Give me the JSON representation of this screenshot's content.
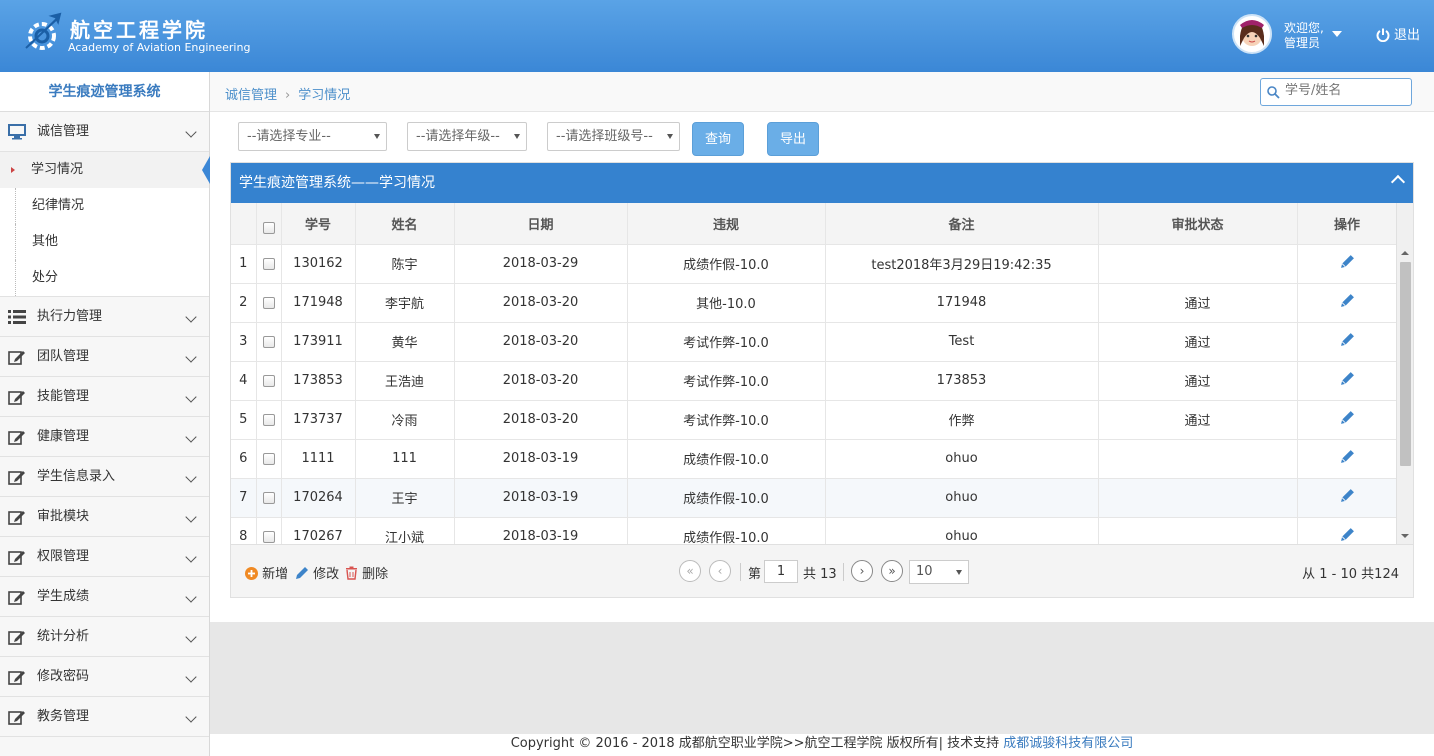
{
  "header": {
    "logo_cn": "航空工程学院",
    "logo_en": "Academy of Aviation Engineering",
    "welcome_line1": "欢迎您,",
    "welcome_line2": "管理员",
    "logout_label": "退出",
    "background_color": "#4a96df"
  },
  "sidebar": {
    "title": "学生痕迹管理系统",
    "items": [
      {
        "label": "诚信管理",
        "icon": "monitor-icon",
        "expanded": true
      },
      {
        "label": "执行力管理",
        "icon": "list-icon"
      },
      {
        "label": "团队管理",
        "icon": "edit-icon"
      },
      {
        "label": "技能管理",
        "icon": "edit-icon"
      },
      {
        "label": "健康管理",
        "icon": "edit-icon"
      },
      {
        "label": "学生信息录入",
        "icon": "edit-icon"
      },
      {
        "label": "审批模块",
        "icon": "edit-icon"
      },
      {
        "label": "权限管理",
        "icon": "edit-icon"
      },
      {
        "label": "学生成绩",
        "icon": "edit-icon"
      },
      {
        "label": "统计分析",
        "icon": "edit-icon"
      },
      {
        "label": "修改密码",
        "icon": "edit-icon"
      },
      {
        "label": "教务管理",
        "icon": "edit-icon"
      }
    ],
    "subitems": [
      "学习情况",
      "纪律情况",
      "其他",
      "处分"
    ]
  },
  "breadcrumb": {
    "parent": "诚信管理",
    "current": "学习情况"
  },
  "search": {
    "placeholder": "学号/姓名"
  },
  "filters": {
    "major": "--请选择专业--",
    "grade": "--请选择年级--",
    "class": "--请选择班级号--",
    "query_label": "查询",
    "export_label": "导出"
  },
  "panel": {
    "title": "学生痕迹管理系统——学习情况"
  },
  "table": {
    "headers": [
      "学号",
      "姓名",
      "日期",
      "违规",
      "备注",
      "审批状态",
      "操作"
    ],
    "rows": [
      {
        "idx": "1",
        "id": "130162",
        "name": "陈宇",
        "date": "2018-03-29",
        "violation": "成绩作假-10.0",
        "note": "test2018年3月29日19:42:35",
        "status": ""
      },
      {
        "idx": "2",
        "id": "171948",
        "name": "李宇航",
        "date": "2018-03-20",
        "violation": "其他-10.0",
        "note": "171948",
        "status": "通过"
      },
      {
        "idx": "3",
        "id": "173911",
        "name": "黄华",
        "date": "2018-03-20",
        "violation": "考试作弊-10.0",
        "note": "Test",
        "status": "通过"
      },
      {
        "idx": "4",
        "id": "173853",
        "name": "王浩迪",
        "date": "2018-03-20",
        "violation": "考试作弊-10.0",
        "note": "173853",
        "status": "通过"
      },
      {
        "idx": "5",
        "id": "173737",
        "name": "冷雨",
        "date": "2018-03-20",
        "violation": "考试作弊-10.0",
        "note": "作弊",
        "status": "通过"
      },
      {
        "idx": "6",
        "id": "1111",
        "name": "111",
        "date": "2018-03-19",
        "violation": "成绩作假-10.0",
        "note": "ohuo",
        "status": ""
      },
      {
        "idx": "7",
        "id": "170264",
        "name": "王宇",
        "date": "2018-03-19",
        "violation": "成绩作假-10.0",
        "note": "ohuo",
        "status": ""
      },
      {
        "idx": "8",
        "id": "170267",
        "name": "江小斌",
        "date": "2018-03-19",
        "violation": "成绩作假-10.0",
        "note": "ohuo",
        "status": ""
      }
    ]
  },
  "pager": {
    "add_label": "新增",
    "edit_label": "修改",
    "delete_label": "删除",
    "page_prefix": "第",
    "page_value": "1",
    "total_pages": "共 13",
    "page_size": "10",
    "summary": "从 1 - 10 共124"
  },
  "footer": {
    "text": "Copyright © 2016 - 2018 成都航空职业学院>>航空工程学院 版权所有| 技术支持 ",
    "link": "成都诚骏科技有限公司"
  }
}
